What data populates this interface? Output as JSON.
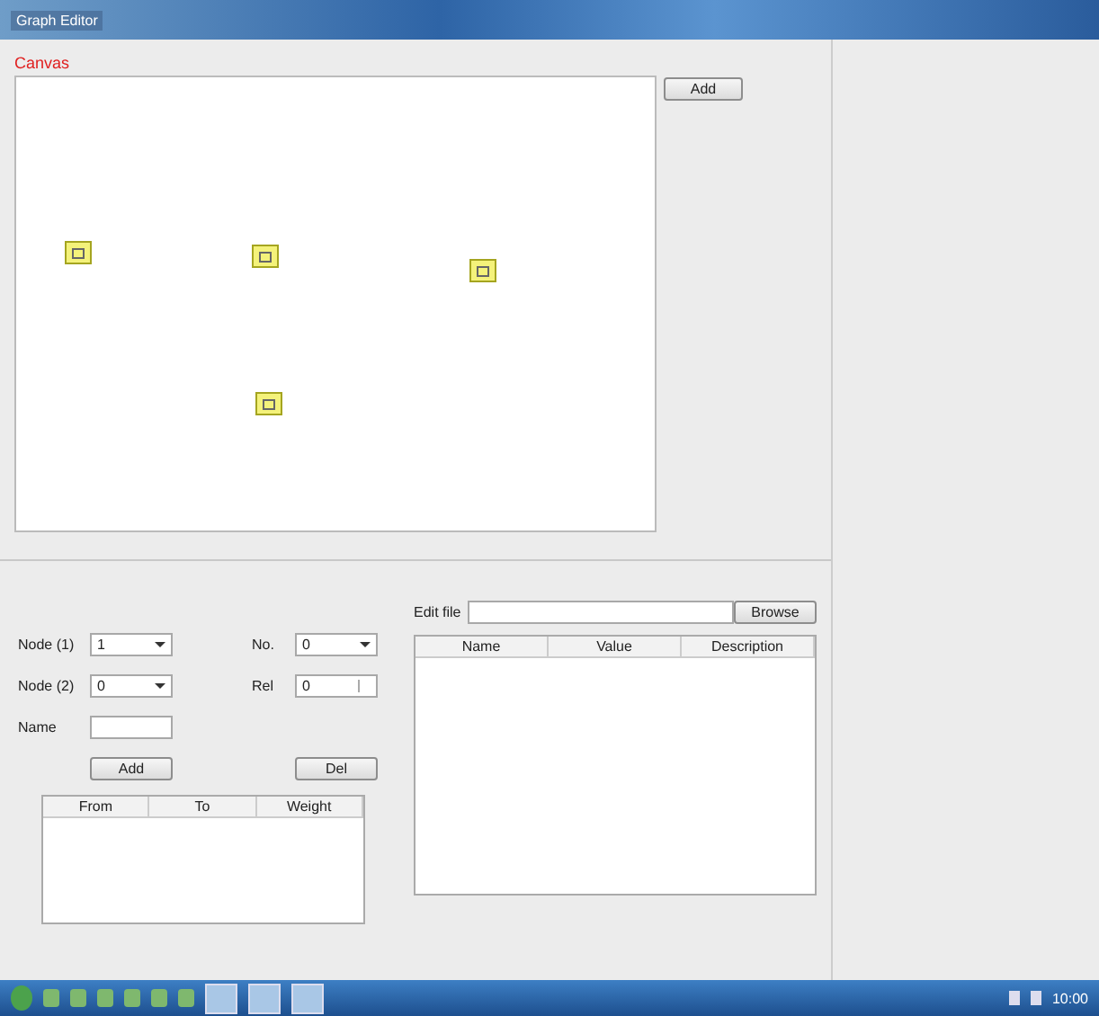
{
  "window": {
    "title": "Graph Editor"
  },
  "canvas": {
    "label": "Canvas",
    "nodes": [
      {
        "kind": "node"
      },
      {
        "kind": "node"
      },
      {
        "kind": "node"
      },
      {
        "kind": "node"
      }
    ]
  },
  "canvas_button": "Add",
  "left_fields": [
    {
      "label": "Node (1)",
      "value": "1",
      "kind": "combo"
    },
    {
      "label": "Node (2)",
      "value": "0",
      "kind": "combo"
    },
    {
      "label": "Name",
      "kind": "text"
    }
  ],
  "right_fields": [
    {
      "label": "No.",
      "value": "0",
      "kind": "combo"
    },
    {
      "label": "Rel",
      "value": "0",
      "kind": "spin"
    }
  ],
  "buttons": [
    "Add",
    "Del"
  ],
  "left_table": {
    "columns": [
      "From",
      "To",
      "Weight"
    ]
  },
  "file": {
    "label": "Edit file",
    "button": "Browse"
  },
  "right_table": {
    "columns": [
      "Name",
      "Value",
      "Description"
    ]
  },
  "taskbar": {
    "clock": "10:00"
  }
}
